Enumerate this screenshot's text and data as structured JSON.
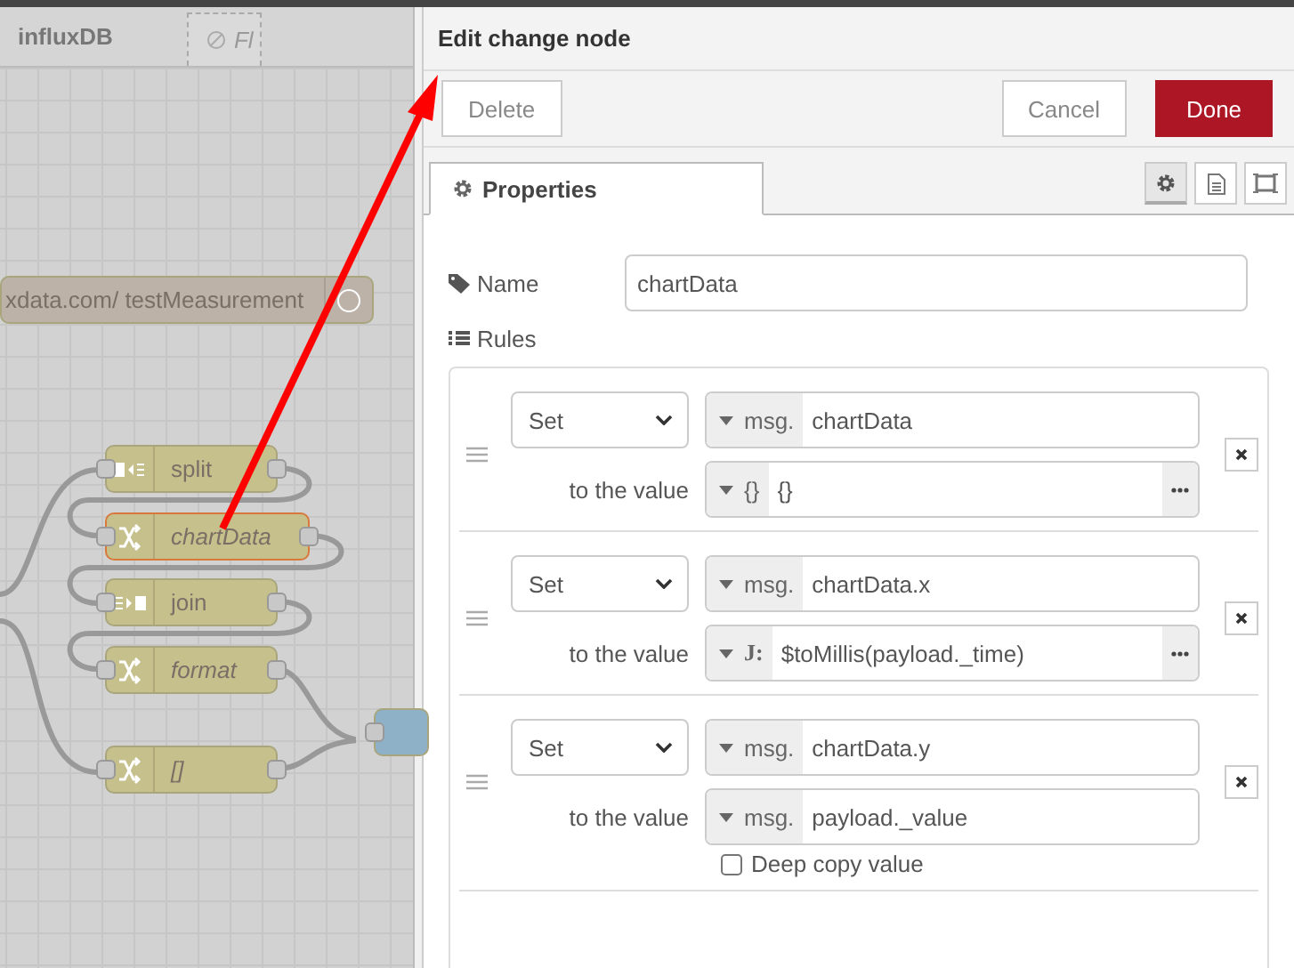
{
  "canvas": {
    "tabs": [
      {
        "label": "influxDB",
        "selected": true
      },
      {
        "label": "Fl",
        "selected": false
      }
    ],
    "nodes": [
      {
        "kind": "request",
        "label": "xdata.com/ testMeasurement",
        "selected": false
      },
      {
        "kind": "split",
        "label": "split",
        "selected": false
      },
      {
        "kind": "change",
        "label": "chartData",
        "selected": true
      },
      {
        "kind": "join",
        "label": "join",
        "selected": false
      },
      {
        "kind": "change",
        "label": "format",
        "selected": false
      },
      {
        "kind": "change",
        "label": "[]",
        "selected": false
      },
      {
        "kind": "output",
        "selected": false
      }
    ]
  },
  "panel": {
    "title": "Edit change node",
    "buttons": [
      {
        "label": "Delete",
        "kind": "plain"
      },
      {
        "label": "Cancel",
        "kind": "plain"
      },
      {
        "label": "Done",
        "kind": "primary"
      }
    ],
    "tabs": [
      {
        "label": "Properties",
        "selected": true
      }
    ],
    "tab_icons": [
      {
        "kind": "settings",
        "selected": true
      },
      {
        "kind": "description",
        "selected": false
      },
      {
        "kind": "appearance",
        "selected": false
      }
    ],
    "name_label": "Name",
    "name_value": "chartData",
    "rules_label": "Rules",
    "rules": [
      {
        "action": "Set",
        "target_type": "msg.",
        "target": "chartData",
        "value_label": "to the value",
        "value_type": "{}",
        "value": "{}",
        "expandable": true
      },
      {
        "action": "Set",
        "target_type": "msg.",
        "target": "chartData.x",
        "value_label": "to the value",
        "value_type": "J:",
        "value": "$toMillis(payload._time)",
        "expandable": true
      },
      {
        "action": "Set",
        "target_type": "msg.",
        "target": "chartData.y",
        "value_label": "to the value",
        "value_type": "msg.",
        "value": "payload._value",
        "expandable": false,
        "deep_copy": {
          "label": "Deep copy value",
          "checked": false
        }
      }
    ]
  }
}
